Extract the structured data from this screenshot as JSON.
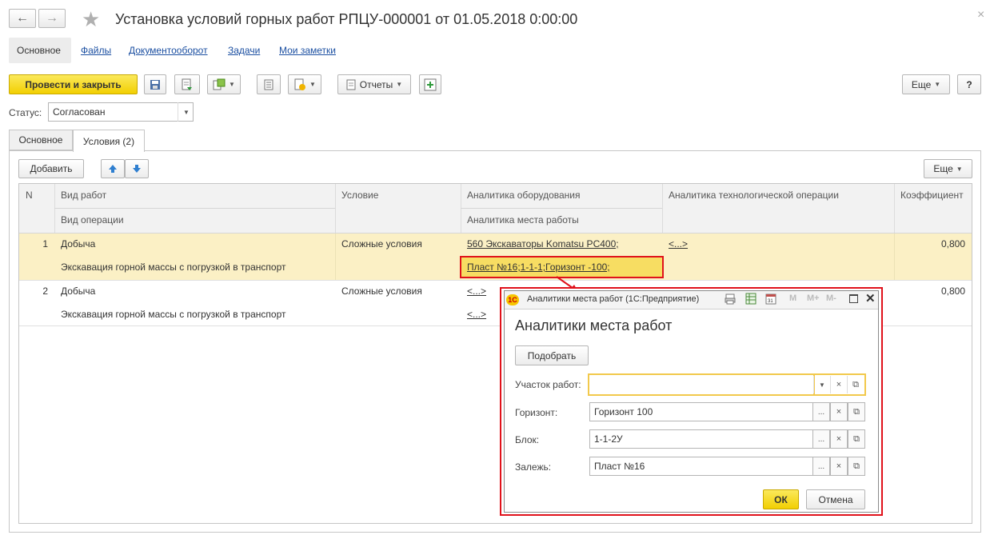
{
  "window": {
    "title": "Установка условий горных работ РПЦУ-000001 от 01.05.2018 0:00:00",
    "close_glyph": "×"
  },
  "nav_tabs": [
    "Основное",
    "Файлы",
    "Документооборот",
    "Задачи",
    "Мои заметки"
  ],
  "toolbar": {
    "post_close_label": "Провести и закрыть",
    "reports_label": "Отчеты",
    "more_label": "Еще",
    "help_label": "?"
  },
  "status": {
    "label": "Статус:",
    "value": "Согласован"
  },
  "form_tabs": [
    "Основное",
    "Условия (2)"
  ],
  "table_toolbar": {
    "add_label": "Добавить",
    "more_label": "Еще"
  },
  "table": {
    "headers": {
      "n": "N",
      "work_type": "Вид работ",
      "operation_type": "Вид операции",
      "condition": "Условие",
      "equipment_analytics": "Аналитика оборудования",
      "workplace_analytics": "Аналитика места работы",
      "tech_op_analytics": "Аналитика технологической операции",
      "coefficient": "Коэффициент"
    },
    "rows": [
      {
        "n": "1",
        "work_type": "Добыча",
        "operation_type": "Экскавация горной массы с погрузкой в транспорт",
        "condition": "Сложные условия",
        "equipment_analytics": "560 Экскаваторы Komatsu PC400;",
        "workplace_analytics": "Пласт №16;1-1-1;Горизонт -100;",
        "tech_op_analytics": "<...>",
        "coefficient": "0,800"
      },
      {
        "n": "2",
        "work_type": "Добыча",
        "operation_type": "Экскавация горной массы с погрузкой в транспорт",
        "condition": "Сложные условия",
        "equipment_analytics": "<...>",
        "workplace_analytics": "<...>",
        "tech_op_analytics": "",
        "coefficient": "0,800"
      }
    ]
  },
  "dialog": {
    "window_title": "Аналитики места работ (1С:Предприятие)",
    "heading": "Аналитики места работ",
    "pick_label": "Подобрать",
    "fields": [
      {
        "label": "Участок работ:",
        "value": ""
      },
      {
        "label": "Горизонт:",
        "value": "Горизонт 100"
      },
      {
        "label": "Блок:",
        "value": "1-1-2У"
      },
      {
        "label": "Залежь:",
        "value": "Пласт №16"
      }
    ],
    "ok_label": "ОК",
    "cancel_label": "Отмена",
    "title_buttons": [
      "M",
      "M+",
      "M-"
    ]
  },
  "colors": {
    "accent_yellow": "#f5d409",
    "selected_row": "#fbf0c5",
    "highlight_red": "#e0121b",
    "link_blue": "#1b4fa1"
  }
}
